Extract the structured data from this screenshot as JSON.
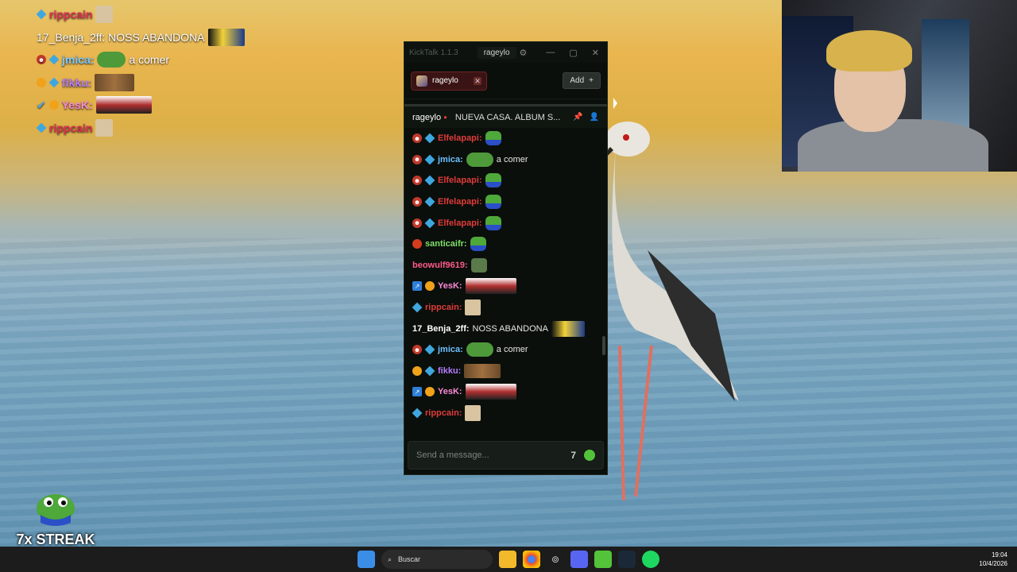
{
  "overlay_chat": [
    {
      "name": "rippcain",
      "color": "#e03050",
      "emote": "cat",
      "text": ""
    },
    {
      "name": "17_Benja_2ff:",
      "color": "#ffffff",
      "emote": "",
      "text": "NOSS ABANDONA",
      "tail_emote": "minion"
    },
    {
      "name": "jmica:",
      "color": "#7ac8ff",
      "emote": "pepe",
      "text": "a comer"
    },
    {
      "name": "fikku:",
      "color": "#b77cff",
      "emote": "faces",
      "text": ""
    },
    {
      "name": "YesK:",
      "color": "#ff8ad8",
      "emote": "lips",
      "text": ""
    },
    {
      "name": "rippcain",
      "color": "#e03050",
      "emote": "cat",
      "text": ""
    }
  ],
  "streak": {
    "label": "7x STREAK"
  },
  "kicktalk": {
    "app_title": "KickTalk 1.1.3",
    "user": "rageylo",
    "tab_label": "rageylo",
    "add_label": "Add",
    "stream_name": "rageylo",
    "stream_title": "NUEVA CASA. ALBUM S...",
    "input_placeholder": "Send a message...",
    "messages": [
      {
        "badges": [
          "mod",
          "sub"
        ],
        "user": "Elfelapapi:",
        "color": "#e03b3b",
        "text": "",
        "emote": "pepe-blue"
      },
      {
        "badges": [
          "mod",
          "sub"
        ],
        "user": "jmica:",
        "color": "#6fc0ff",
        "text": "a comer",
        "emote": "pepe"
      },
      {
        "badges": [
          "mod",
          "sub"
        ],
        "user": "Elfelapapi:",
        "color": "#e03b3b",
        "text": "",
        "emote": "pepe-blue"
      },
      {
        "badges": [
          "mod",
          "sub"
        ],
        "user": "Elfelapapi:",
        "color": "#e03b3b",
        "text": "",
        "emote": "pepe-blue"
      },
      {
        "badges": [
          "mod",
          "sub"
        ],
        "user": "Elfelapapi:",
        "color": "#e03b3b",
        "text": "",
        "emote": "pepe-blue"
      },
      {
        "badges": [
          "red"
        ],
        "user": "santicaifr:",
        "color": "#7fe06a",
        "text": "",
        "emote": "pepe-blue"
      },
      {
        "badges": [],
        "user": "beowulf9619:",
        "color": "#ff5a8a",
        "text": "",
        "emote": "pepe-pray"
      },
      {
        "badges": [
          "vip",
          "gold"
        ],
        "user": "YesK:",
        "color": "#ff8ad8",
        "text": "",
        "emote": "lips"
      },
      {
        "badges": [
          "sub"
        ],
        "user": "rippcain:",
        "color": "#e03b3b",
        "text": "",
        "emote": "cat"
      },
      {
        "badges": [],
        "user": "17_Benja_2ff:",
        "color": "#ffffff",
        "text": "NOSS ABANDONA",
        "emote": "minion"
      },
      {
        "badges": [
          "mod",
          "sub"
        ],
        "user": "jmica:",
        "color": "#6fc0ff",
        "text": "a comer",
        "emote": "pepe"
      },
      {
        "badges": [
          "gold",
          "sub"
        ],
        "user": "fikku:",
        "color": "#b77cff",
        "text": "",
        "emote": "faces"
      },
      {
        "badges": [
          "vip",
          "gold"
        ],
        "user": "YesK:",
        "color": "#ff8ad8",
        "text": "",
        "emote": "lips"
      },
      {
        "badges": [
          "sub"
        ],
        "user": "rippcain:",
        "color": "#e03b3b",
        "text": "",
        "emote": "cat"
      }
    ]
  },
  "taskbar": {
    "search_label": "Buscar",
    "time": "19:04",
    "date": "10/4/2026"
  }
}
